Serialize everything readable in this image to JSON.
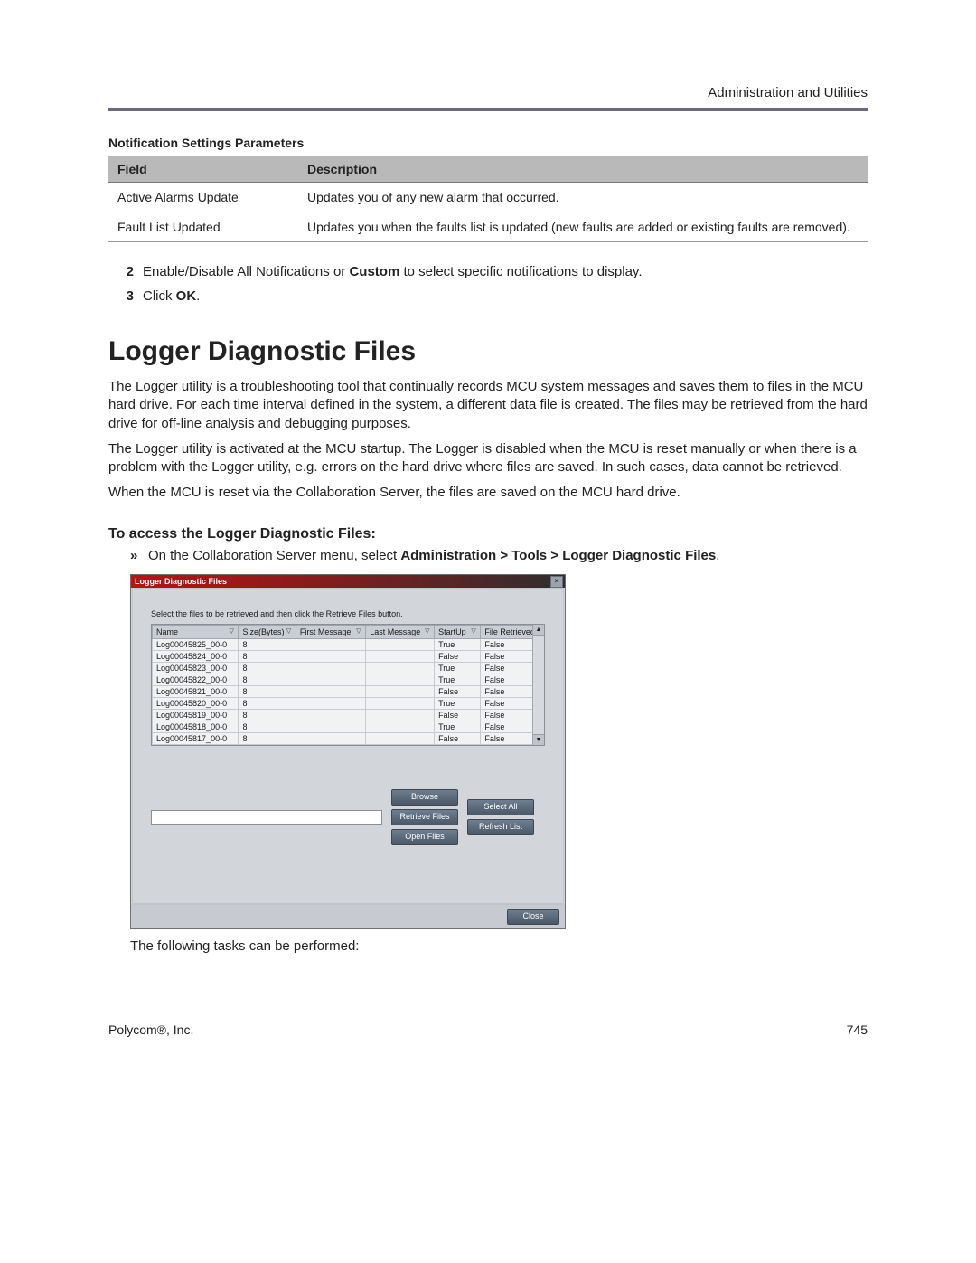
{
  "header": {
    "right": "Administration and Utilities"
  },
  "params_table": {
    "title": "Notification Settings Parameters",
    "head": {
      "field": "Field",
      "desc": "Description"
    },
    "rows": [
      {
        "field": "Active Alarms Update",
        "desc": "Updates you of any new alarm that occurred."
      },
      {
        "field": "Fault List Updated",
        "desc": "Updates you when the faults list is updated (new faults are added or existing faults are removed)."
      }
    ]
  },
  "steps": {
    "s2": {
      "num": "2",
      "pre": "Enable/Disable All Notifications or ",
      "bold": "Custom",
      "post": " to select specific notifications to display."
    },
    "s3": {
      "num": "3",
      "pre": "Click ",
      "bold": "OK",
      "post": "."
    }
  },
  "section_h1": "Logger Diagnostic Files",
  "para1": "The Logger utility is a troubleshooting tool that continually records MCU system messages and saves them to files in the MCU hard drive. For each time interval defined in the system, a different data file is created. The files may be retrieved from the hard drive for off-line analysis and debugging purposes.",
  "para2": "The Logger utility is activated at the MCU startup. The Logger is disabled when the MCU is reset manually or when there is a problem with the Logger utility, e.g. errors on the hard drive where files are saved. In such cases, data cannot be retrieved.",
  "para3": "When the MCU is reset via the Collaboration Server, the files are saved on the MCU hard drive.",
  "subhead": "To access the Logger Diagnostic Files:",
  "bullet": {
    "mark": "»",
    "pre": "On the Collaboration Server menu, select ",
    "bold": "Administration > Tools > Logger Diagnostic Files",
    "post": "."
  },
  "dialog": {
    "title": "Logger Diagnostic Files",
    "close": "×",
    "instruction": "Select the files to be retrieved and then click the Retrieve Files button.",
    "cols": {
      "name": "Name",
      "size": "Size(Bytes)",
      "first": "First Message",
      "last": "Last Message",
      "startup": "StartUp",
      "ret": "File Retrieved"
    },
    "rows": [
      {
        "name": "Log00045825_00-0",
        "size": "8",
        "first": "",
        "last": "",
        "startup": "True",
        "ret": "False"
      },
      {
        "name": "Log00045824_00-0",
        "size": "8",
        "first": "",
        "last": "",
        "startup": "False",
        "ret": "False"
      },
      {
        "name": "Log00045823_00-0",
        "size": "8",
        "first": "",
        "last": "",
        "startup": "True",
        "ret": "False"
      },
      {
        "name": "Log00045822_00-0",
        "size": "8",
        "first": "",
        "last": "",
        "startup": "True",
        "ret": "False"
      },
      {
        "name": "Log00045821_00-0",
        "size": "8",
        "first": "",
        "last": "",
        "startup": "False",
        "ret": "False"
      },
      {
        "name": "Log00045820_00-0",
        "size": "8",
        "first": "",
        "last": "",
        "startup": "True",
        "ret": "False"
      },
      {
        "name": "Log00045819_00-0",
        "size": "8",
        "first": "",
        "last": "",
        "startup": "False",
        "ret": "False"
      },
      {
        "name": "Log00045818_00-0",
        "size": "8",
        "first": "",
        "last": "",
        "startup": "True",
        "ret": "False"
      },
      {
        "name": "Log00045817_00-0",
        "size": "8",
        "first": "",
        "last": "",
        "startup": "False",
        "ret": "False"
      }
    ],
    "buttons": {
      "browse": "Browse",
      "select_all": "Select All",
      "retrieve": "Retrieve Files",
      "refresh": "Refresh List",
      "open": "Open Files",
      "close": "Close"
    },
    "scroll_up": "▲",
    "scroll_dn": "▼"
  },
  "after_dlg": "The following tasks can be performed:",
  "footer": {
    "left": "Polycom®, Inc.",
    "right": "745"
  }
}
